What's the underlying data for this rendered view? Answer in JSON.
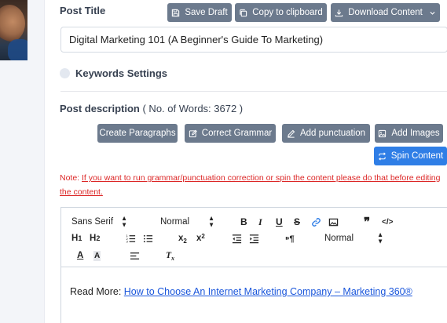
{
  "post_title": {
    "label": "Post Title",
    "value": "Digital Marketing 101 (A Beginner's Guide To Marketing)"
  },
  "top_actions": {
    "save_draft": "Save Draft",
    "copy_clipboard": "Copy to clipboard",
    "download": "Download Content"
  },
  "keywords": {
    "label": "Keywords Settings"
  },
  "description": {
    "label": "Post description",
    "word_count": "( No. of Words: 3672 )"
  },
  "tools": {
    "create_paragraphs": "Create Paragraphs",
    "correct_grammar": "Correct Grammar",
    "add_punctuation": "Add punctuation",
    "add_images": "Add Images",
    "spin_content": "Spin Content"
  },
  "note": {
    "prefix": "Note: ",
    "text": "If you want to run grammar/punctuation correction or spin the content please do that before editing the content."
  },
  "editor": {
    "font": "Sans Serif",
    "size": "Normal",
    "header": "Normal",
    "content": {
      "prefix": "Read More: ",
      "link": "How to Choose An Internet Marketing Company – Marketing 360®"
    }
  },
  "colors": {
    "primary": "#2f7ee6",
    "secondary": "#6c7a8d",
    "danger": "#dc2626",
    "link": "#1a56db"
  }
}
